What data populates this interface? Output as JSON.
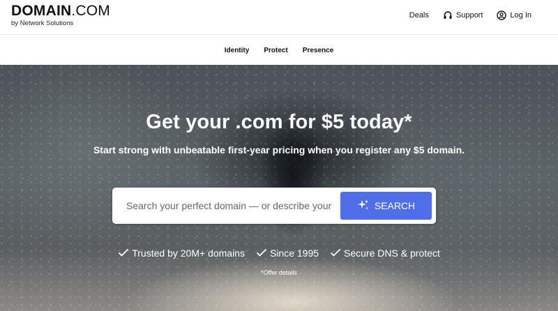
{
  "header": {
    "logo_main": "DOMAIN",
    "logo_suffix": ".COM",
    "logo_sub": "by Network Solutions",
    "nav": [
      {
        "label": "Deals",
        "icon": null
      },
      {
        "label": "Support",
        "icon": "headset-icon"
      },
      {
        "label": "Log In",
        "icon": "user-circle-icon"
      }
    ]
  },
  "subnav": {
    "items": [
      "Identity",
      "Protect",
      "Presence"
    ]
  },
  "hero": {
    "title": "Get your .com for $5 today*",
    "subtitle": "Start strong with unbeatable first-year pricing when you register any $5 domain.",
    "search": {
      "placeholder": "Search your perfect domain — or describe your idea",
      "value": "",
      "button_label": "SEARCH",
      "button_icon": "sparkle-icon",
      "button_color": "#4f6ee8"
    },
    "trust_items": [
      "Trusted by 20M+ domains",
      "Since 1995",
      "Secure DNS & protect"
    ],
    "offer_text": "*Offer details"
  }
}
